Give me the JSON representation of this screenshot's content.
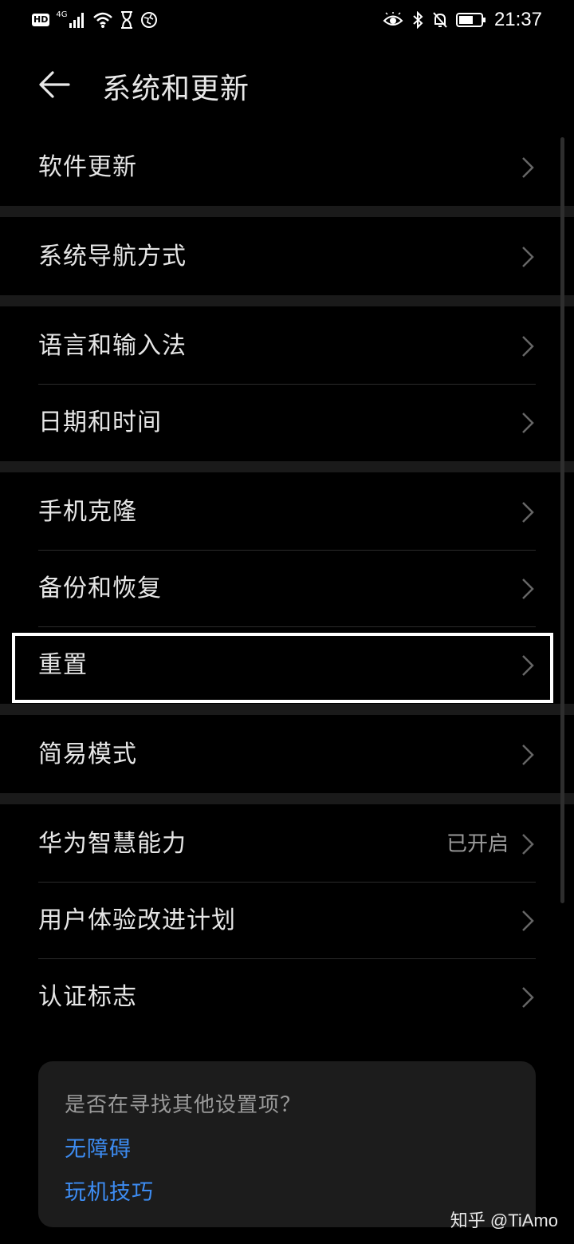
{
  "status_bar": {
    "hd": "HD",
    "network": "4G",
    "time": "21:37",
    "icons": [
      "hd-icon",
      "signal-icon",
      "wifi-icon",
      "hourglass-icon",
      "vpn-globe-icon",
      "eye-comfort-icon",
      "bluetooth-icon",
      "mute-notification-icon",
      "battery-icon"
    ]
  },
  "header": {
    "title": "系统和更新",
    "back_icon": "back-arrow-icon"
  },
  "groups": [
    {
      "items": [
        {
          "label": "软件更新"
        }
      ]
    },
    {
      "items": [
        {
          "label": "系统导航方式"
        }
      ]
    },
    {
      "items": [
        {
          "label": "语言和输入法"
        },
        {
          "label": "日期和时间"
        }
      ]
    },
    {
      "items": [
        {
          "label": "手机克隆"
        },
        {
          "label": "备份和恢复"
        },
        {
          "label": "重置"
        }
      ]
    },
    {
      "items": [
        {
          "label": "简易模式"
        }
      ]
    },
    {
      "items": [
        {
          "label": "华为智慧能力",
          "value": "已开启"
        },
        {
          "label": "用户体验改进计划"
        },
        {
          "label": "认证标志"
        }
      ]
    }
  ],
  "card": {
    "title": "是否在寻找其他设置项？",
    "links": [
      "无障碍",
      "玩机技巧"
    ]
  },
  "watermark": "知乎 @TiAmo",
  "colors": {
    "background": "#000000",
    "band": "#1a1a1a",
    "link": "#3d8cf2",
    "highlight": "#ffffff"
  }
}
